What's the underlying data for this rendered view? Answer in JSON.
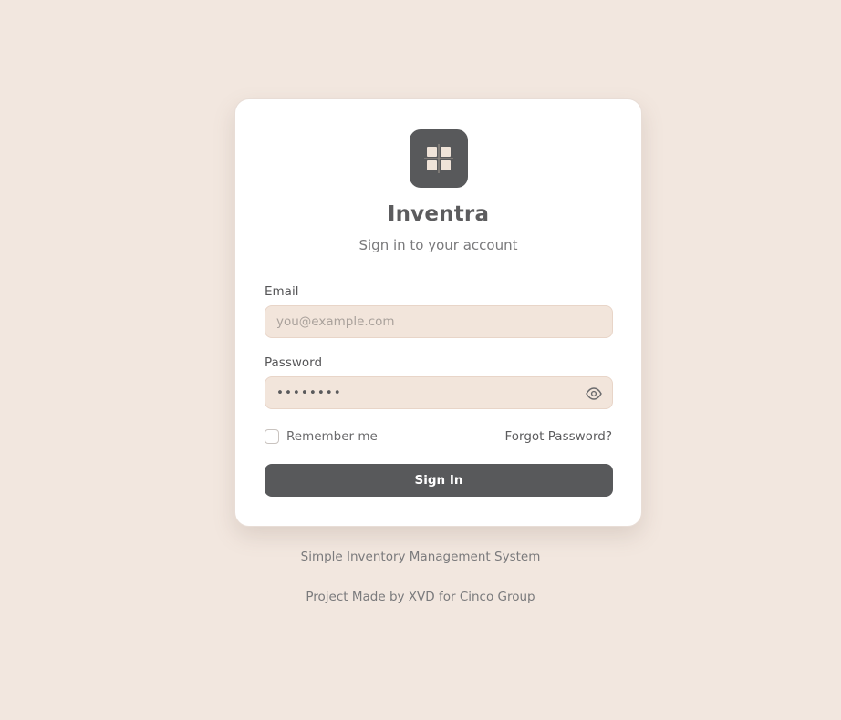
{
  "app": {
    "name": "Inventra",
    "subtitle": "Sign in to your account",
    "logo_icon": "grid-icon"
  },
  "form": {
    "email": {
      "label": "Email",
      "placeholder": "you@example.com",
      "value": ""
    },
    "password": {
      "label": "Password",
      "value": "••••••••",
      "toggle_icon": "eye-icon"
    },
    "remember_label": "Remember me",
    "remember_checked": false,
    "forgot_label": "Forgot Password?",
    "submit_label": "Sign In"
  },
  "footer": {
    "tagline": "Simple Inventory Management System",
    "credit": "Project Made by XVD for Cinco Group"
  },
  "colors": {
    "background": "#f2e7df",
    "card": "#ffffff",
    "primary": "#58595b",
    "input_bg": "#f2e5db"
  }
}
